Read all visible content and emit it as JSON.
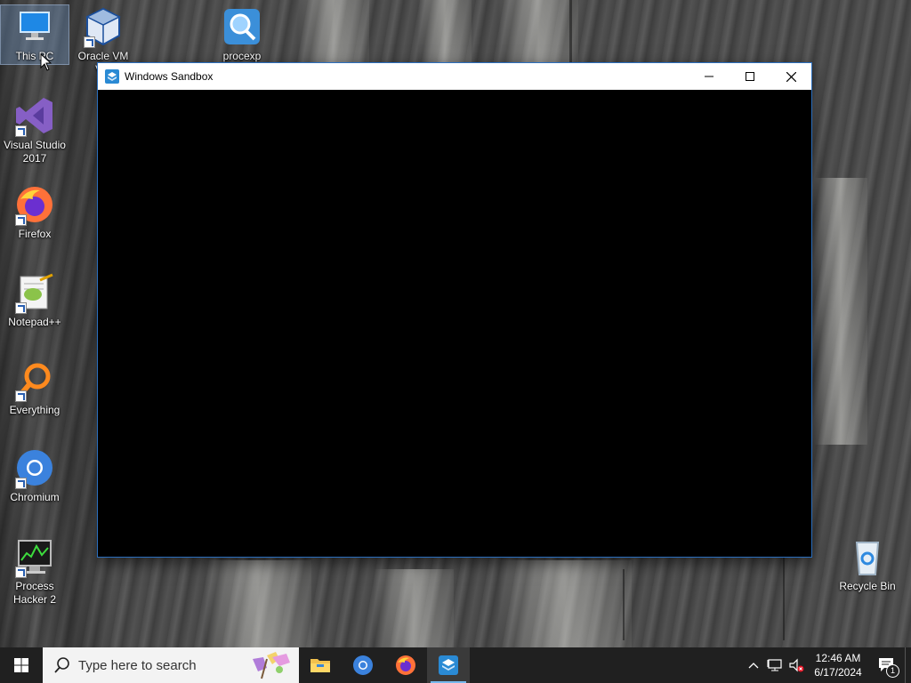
{
  "desktop": {
    "icons": [
      {
        "label": "This PC",
        "icon": "monitor-icon"
      },
      {
        "label": "Oracle VM Virt",
        "icon": "virtualbox-icon"
      },
      {
        "label": "procexp",
        "icon": "magnifier-icon"
      },
      {
        "label": "Visual Studio 2017",
        "icon": "visual-studio-icon"
      },
      {
        "label": "Firefox",
        "icon": "firefox-icon"
      },
      {
        "label": "Notepad++",
        "icon": "notepadpp-icon"
      },
      {
        "label": "Everything",
        "icon": "everything-search-icon"
      },
      {
        "label": "Chromium",
        "icon": "chromium-icon"
      },
      {
        "label": "Process Hacker 2",
        "icon": "process-hacker-icon"
      },
      {
        "label": "Recycle Bin",
        "icon": "recycle-bin-icon"
      }
    ]
  },
  "window": {
    "title": "Windows Sandbox",
    "minimize": "minimize-icon",
    "maximize": "maximize-icon",
    "close": "close-icon"
  },
  "taskbar": {
    "search_placeholder": "Type here to search",
    "pinned": [
      "file-explorer-icon",
      "chromium-icon",
      "firefox-icon",
      "windows-sandbox-icon"
    ],
    "active": "windows-sandbox-icon",
    "clock": {
      "time": "12:46 AM",
      "date": "6/17/2024"
    },
    "notifications_count": "1"
  },
  "colors": {
    "taskbar": "#202020",
    "accent": "#76b9ed",
    "window_client": "#000000"
  }
}
